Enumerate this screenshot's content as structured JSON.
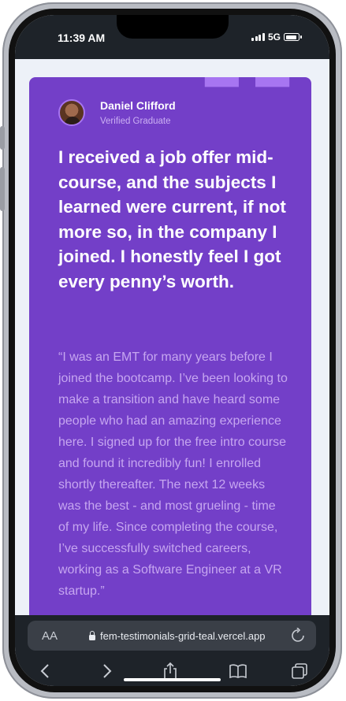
{
  "status_bar": {
    "time": "11:39 AM",
    "network": "5G"
  },
  "testimonial": {
    "name": "Daniel Clifford",
    "subtitle": "Verified Graduate",
    "headline": "I received a job offer mid-course, and the subjects I learned were current, if not more so, in the company I joined. I honestly feel I got every penny’s worth.",
    "body": "“I was an EMT for many years before I joined the bootcamp. I’ve been looking to make a transition and have heard some people who had an amazing experience here. I signed up for the free intro course and found it incredibly fun! I enrolled shortly thereafter. The next 12 weeks was the best - and most grueling - time of my life. Since completing the course, I’ve successfully switched careers, working as a Software Engineer at a VR startup.”",
    "quote_glyph": "“",
    "colors": {
      "card": "#733fc8",
      "quote_mark": "#a775f1",
      "body_text": "#c6a6f0",
      "page_bg": "#edf1f8"
    }
  },
  "browser": {
    "text_size_label": "AA",
    "url": "fem-testimonials-grid-teal.vercel.app",
    "icons": [
      "lock-icon",
      "reload-icon",
      "back-icon",
      "forward-icon",
      "share-icon",
      "bookmarks-icon",
      "tabs-icon"
    ]
  }
}
